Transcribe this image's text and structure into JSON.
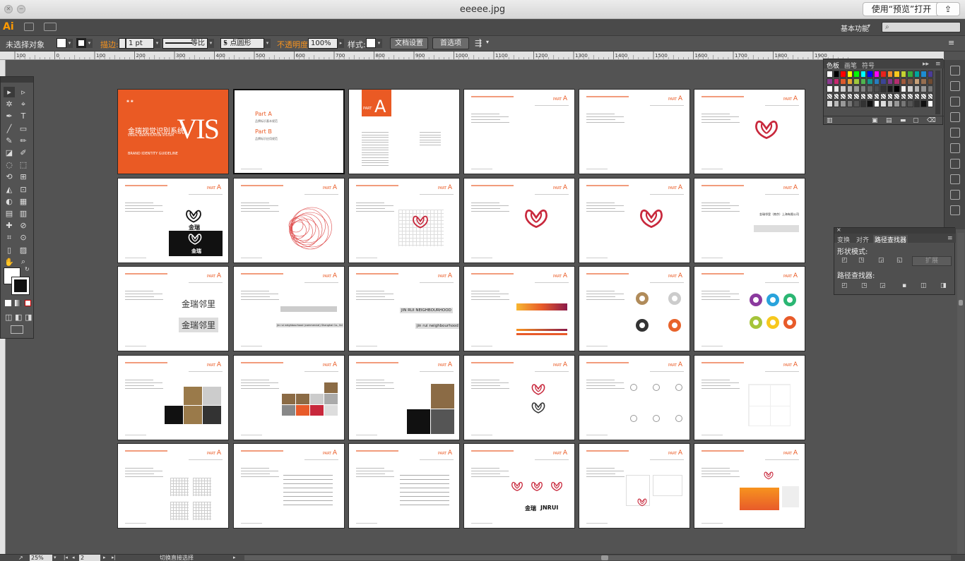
{
  "window": {
    "title": "eeeee.jpg",
    "open_with_preview": "使用“预览”打开",
    "share_icon": "share-icon"
  },
  "appbar": {
    "logo": "Ai",
    "workspace": "基本功能",
    "search_placeholder": ""
  },
  "control": {
    "selection": "未选择对象",
    "stroke_label": "描边:",
    "stroke_value": "1 pt",
    "stroke_profile": "等比",
    "brush": "5 点圆形",
    "opacity_label": "不透明度:",
    "opacity_value": "100%",
    "style_label": "样式:",
    "doc_setup": "文档设置",
    "preferences": "首选项"
  },
  "ruler_ticks": [
    "100",
    "0",
    "100",
    "200",
    "300",
    "400",
    "500",
    "600",
    "700",
    "800",
    "900",
    "1000",
    "1100",
    "1200",
    "1300",
    "1400",
    "1500",
    "1600",
    "1700",
    "1800",
    "1900"
  ],
  "swatches_panel": {
    "tabs": [
      "色板",
      "画笔",
      "符号"
    ]
  },
  "pathfinder_panel": {
    "tabs": [
      "变换",
      "对齐",
      "路径查找器"
    ],
    "shape_modes": "形状模式:",
    "expand": "扩展",
    "pathfinders": "路径查找器:"
  },
  "cover": {
    "vis": "VIS",
    "title_cn": "金瑞视觉识别系统",
    "title_en": "VISUAL IDENTIFICATION SYSTEM",
    "guideline": "BRAND IDENTITY GUIDELINE"
  },
  "toc": {
    "part_a": "Part A",
    "part_b": "Part B",
    "part_a_desc": "品牌标识基本规范",
    "part_b_desc": "品牌标识应用规范"
  },
  "part_label": "PART",
  "part_letter": "A",
  "brand": {
    "logo_cn": "金瑞",
    "name_cn": "金瑞邻里",
    "name_en_caps": "JIN RUI NEIGHBOURHOOD",
    "name_en_lower": "jin rui neighbourhood",
    "company_cn": "金瑞邻里（南京）上海有限公司",
    "company_en": "jin rui neighbourhood (commercial) Shanghai Co., ltd",
    "logo_en": "JNRUI"
  },
  "status": {
    "zoom": "25%",
    "artboard": "2",
    "tool_hint": "切换直接选择"
  },
  "colors": {
    "brand_orange": "#ea5a24",
    "accent_orange": "#f7931e"
  }
}
